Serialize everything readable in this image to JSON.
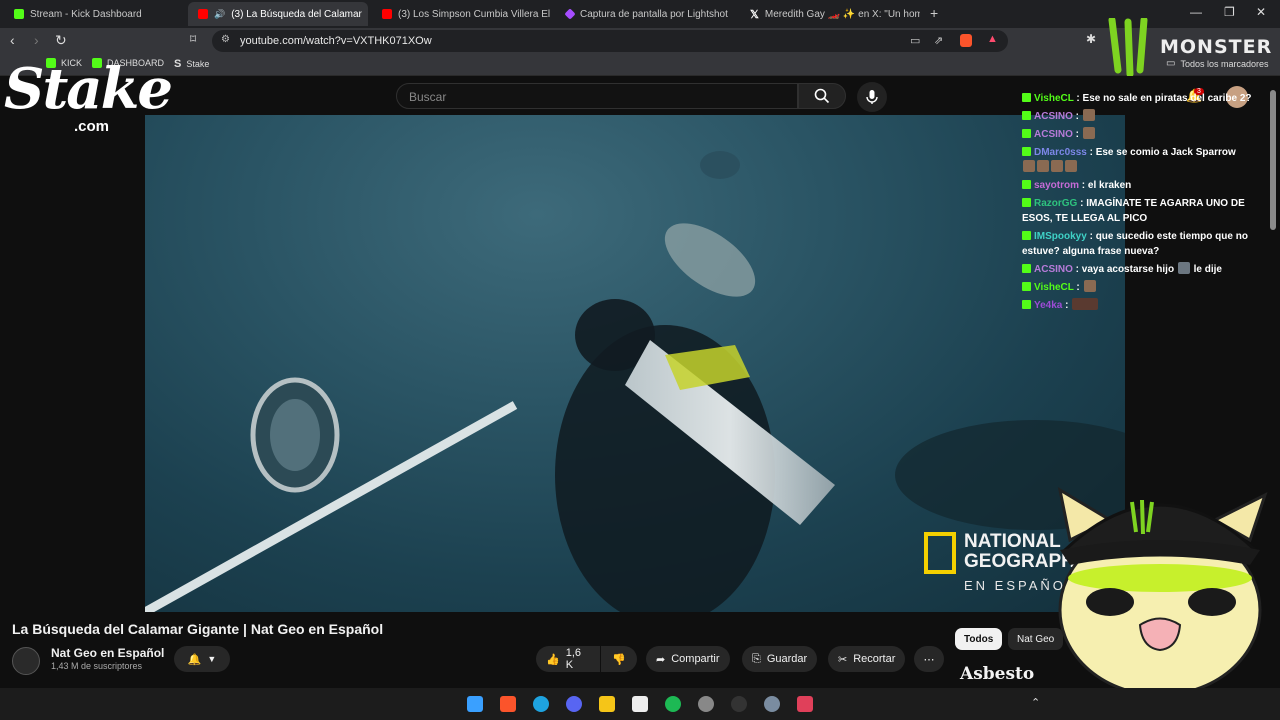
{
  "browser": {
    "tabs": [
      {
        "label": "Stream - Kick Dashboard",
        "color": "#53fc18"
      },
      {
        "label": "(3) La Búsqueda del Calamar",
        "color": "#ff0000"
      },
      {
        "label": "(3) Los Simpson Cumbia Villera El Pr",
        "color": "#ff0000"
      },
      {
        "label": "Captura de pantalla por Lightshot",
        "color": "#a64dff"
      },
      {
        "label": "Meredith Gay 🏎️ ✨ en X: \"Un homb",
        "color": "#ffffff"
      }
    ],
    "new_tab_label": "+",
    "url": "youtube.com/watch?v=VXTHK071XOw",
    "bookmarks": [
      {
        "label": "KICK",
        "color": "#53fc18"
      },
      {
        "label": "DASHBOARD",
        "color": "#53fc18"
      },
      {
        "label": "Stake",
        "color": "#ffffff"
      }
    ],
    "all_bookmarks_label": "Todos los marcadores"
  },
  "youtube": {
    "search_placeholder": "Buscar",
    "notification_count": "3",
    "video_title": "La Búsqueda del Calamar Gigante | Nat Geo en Español",
    "channel_name": "Nat Geo en Español",
    "subscribers": "1,43 M de suscriptores",
    "like_count": "1,6 K",
    "share_label": "Compartir",
    "save_label": "Guardar",
    "clip_label": "Recortar",
    "chips": [
      "Todos",
      "Nat Geo"
    ],
    "watermark": {
      "line1": "NATIONAL",
      "line2": "GEOGRAPHI",
      "line3": "EN ESPAÑO"
    }
  },
  "overlays": {
    "stake_logo": "Stake",
    "stake_com": ".com",
    "monster_logo": "MONSTER",
    "nameplate": "Asbesto"
  },
  "chat": [
    {
      "user": "VisheCL",
      "color": "#53fc18",
      "text": "Ese no sale en piratas del caribe 2?"
    },
    {
      "user": "ACSINO",
      "color": "#b77bd9",
      "text": "",
      "emotes": 1
    },
    {
      "user": "ACSINO",
      "color": "#b77bd9",
      "text": "",
      "emotes": 1
    },
    {
      "user": "DMarc0sss",
      "color": "#7d87e8",
      "text": "Ese se comio a Jack Sparrow",
      "emotes": 4
    },
    {
      "user": "sayotrom",
      "color": "#c56bd6",
      "text": "el kraken"
    },
    {
      "user": "RazorGG",
      "color": "#2ec27e",
      "text": "IMAGÍNATE TE AGARRA UNO DE ESOS, TE LLEGA AL PICO"
    },
    {
      "user": "IMSpookyy",
      "color": "#3fd1c6",
      "text": "que sucedio este tiempo que no estuve? alguna frase nueva?"
    },
    {
      "user": "ACSINO",
      "color": "#b77bd9",
      "text": "vaya acostarse hijo",
      "text2": "le dije",
      "emotes": 1
    },
    {
      "user": "VisheCL",
      "color": "#53fc18",
      "text": "",
      "emotes": 1
    },
    {
      "user": "Ye4ka",
      "color": "#9d4bd6",
      "text": "",
      "emotes": 1
    }
  ]
}
